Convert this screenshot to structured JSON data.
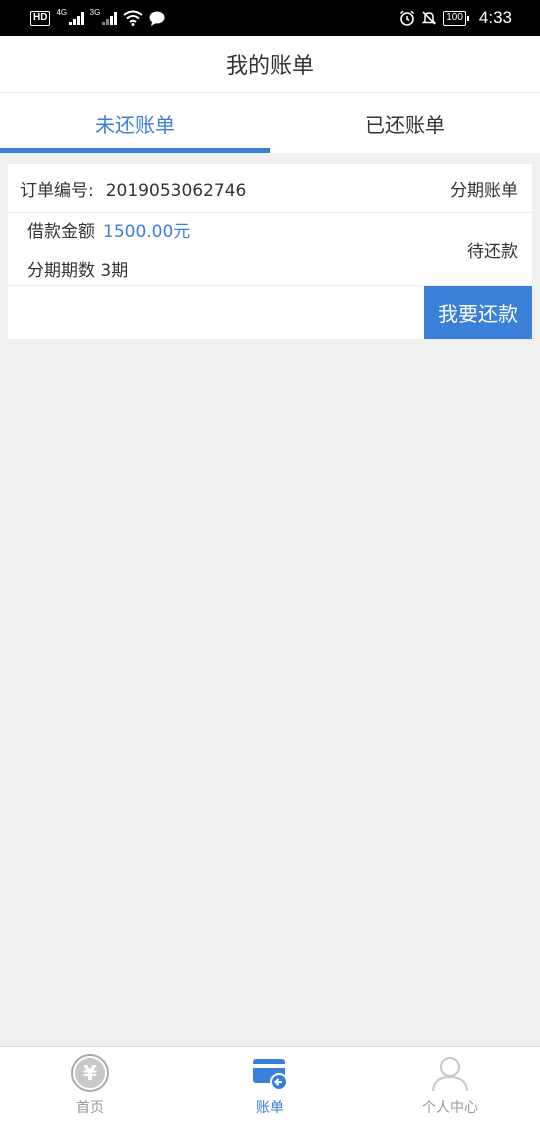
{
  "status_bar": {
    "hd_label": "HD",
    "net_4g": "4G",
    "net_3g": "3G",
    "battery": "100",
    "time": "4:33"
  },
  "header": {
    "title": "我的账单"
  },
  "tabs": [
    {
      "label": "未还账单",
      "active": true
    },
    {
      "label": "已还账单",
      "active": false
    }
  ],
  "bill": {
    "order_no_label": "订单编号:",
    "order_no": "2019053062746",
    "bill_type": "分期账单",
    "amount_label": "借款金额",
    "amount": "1500.00元",
    "periods_label": "分期期数",
    "periods": "3期",
    "status": "待还款",
    "repay_button": "我要还款"
  },
  "bottom_nav": [
    {
      "label": "首页",
      "icon": "yen-icon",
      "active": false
    },
    {
      "label": "账单",
      "icon": "bill-card-icon",
      "active": true
    },
    {
      "label": "个人中心",
      "icon": "person-icon",
      "active": false
    }
  ],
  "colors": {
    "accent": "#3a7fd8",
    "background": "#f0f0f0"
  }
}
